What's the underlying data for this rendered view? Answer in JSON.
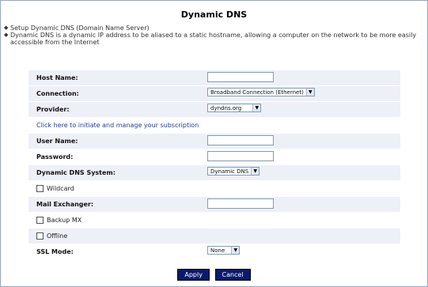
{
  "page": {
    "title": "Dynamic DNS",
    "intro": [
      "Setup Dynamic DNS (Domain Name Server)",
      "Dynamic DNS is a dynamic IP address to be aliased to a static hostname, allowing a computer on the network to be more easily accessible from the Internet"
    ]
  },
  "form": {
    "host_name": {
      "label": "Host Name:",
      "value": ""
    },
    "connection": {
      "label": "Connection:",
      "value": "Broadband Connection (Ethernet)"
    },
    "provider": {
      "label": "Provider:",
      "value": "dyndns.org"
    },
    "subscription_link": "Click here to initiate and manage your subscription",
    "user_name": {
      "label": "User Name:",
      "value": ""
    },
    "password": {
      "label": "Password:",
      "value": ""
    },
    "dns_system": {
      "label": "Dynamic DNS System:",
      "value": "Dynamic DNS"
    },
    "wildcard": {
      "label": "Wildcard",
      "checked": false
    },
    "mail_exchanger": {
      "label": "Mail Exchanger:",
      "value": ""
    },
    "backup_mx": {
      "label": "Backup MX",
      "checked": false
    },
    "offline": {
      "label": "Offline",
      "checked": false
    },
    "ssl_mode": {
      "label": "SSL Mode:",
      "value": "None"
    }
  },
  "buttons": {
    "apply": "Apply",
    "cancel": "Cancel"
  },
  "icons": {
    "dropdown": "chevron-down-icon",
    "bullet": "diamond-bullet-icon"
  },
  "colors": {
    "button_bg": "#0a1a6b",
    "row_shade": "#eef0f7",
    "link": "#1e3f9a"
  }
}
